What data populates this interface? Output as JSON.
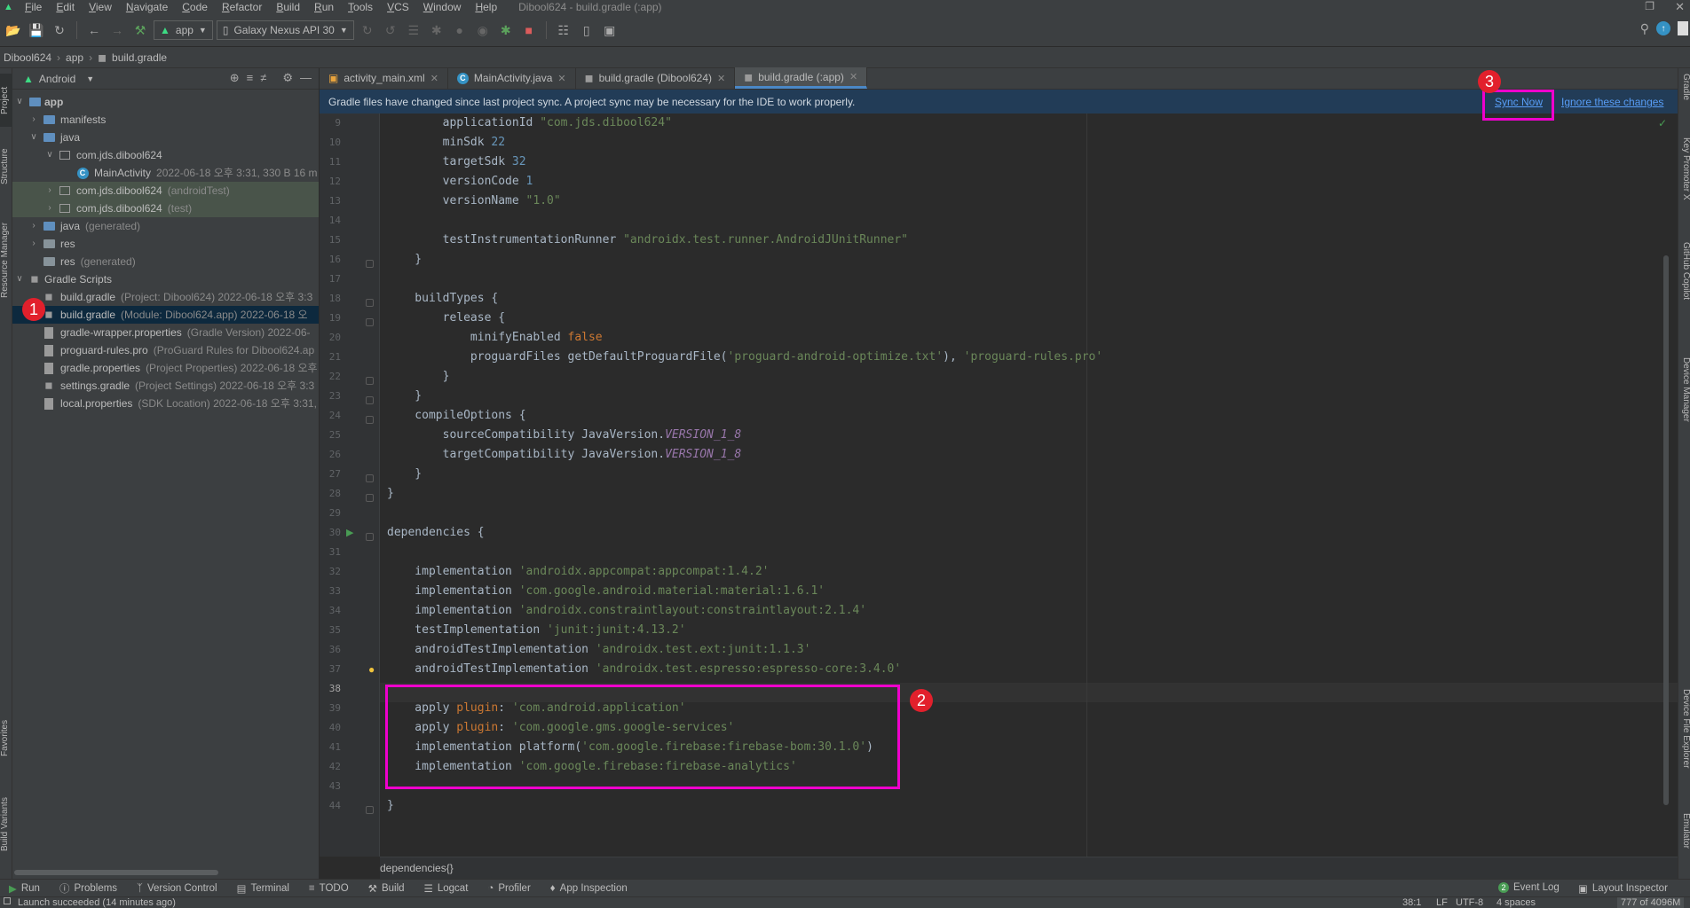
{
  "window_title": "Dibool624 - build.gradle (:app)",
  "menu": [
    "File",
    "Edit",
    "View",
    "Navigate",
    "Code",
    "Refactor",
    "Build",
    "Run",
    "Tools",
    "VCS",
    "Window",
    "Help"
  ],
  "toolbar": {
    "run_config": "app",
    "device": "Galaxy Nexus API 30"
  },
  "breadcrumb": [
    "Dibool624",
    "app",
    "build.gradle"
  ],
  "left_strip": [
    "Project",
    "Structure",
    "Resource Manager",
    "Favorites",
    "Build Variants"
  ],
  "right_strip": [
    "Gradle",
    "Key Promoter X",
    "GitHub Copilot",
    "Device Manager",
    "Device File Explorer",
    "Emulator"
  ],
  "project_panel": {
    "view_mode": "Android"
  },
  "tree": [
    {
      "label": "app",
      "meta": ""
    },
    {
      "label": "manifests",
      "meta": ""
    },
    {
      "label": "java",
      "meta": ""
    },
    {
      "label": "com.jds.dibool624",
      "meta": ""
    },
    {
      "label": "MainActivity",
      "meta": "2022-06-18 오후 3:31, 330 B 16 m"
    },
    {
      "label": "com.jds.dibool624",
      "meta": "(androidTest)"
    },
    {
      "label": "com.jds.dibool624",
      "meta": "(test)"
    },
    {
      "label": "java",
      "meta": "(generated)"
    },
    {
      "label": "res",
      "meta": ""
    },
    {
      "label": "res",
      "meta": "(generated)"
    },
    {
      "label": "Gradle Scripts",
      "meta": ""
    },
    {
      "label": "build.gradle",
      "meta": "(Project: Dibool624)  2022-06-18 오후 3:3"
    },
    {
      "label": "build.gradle",
      "meta": "(Module: Dibool624.app)  2022-06-18 오"
    },
    {
      "label": "gradle-wrapper.properties",
      "meta": "(Gradle Version)  2022-06-"
    },
    {
      "label": "proguard-rules.pro",
      "meta": "(ProGuard Rules for Dibool624.ap"
    },
    {
      "label": "gradle.properties",
      "meta": "(Project Properties)  2022-06-18 오후"
    },
    {
      "label": "settings.gradle",
      "meta": "(Project Settings)  2022-06-18 오후 3:3"
    },
    {
      "label": "local.properties",
      "meta": "(SDK Location)  2022-06-18 오후 3:31,"
    }
  ],
  "tabs": [
    "activity_main.xml",
    "MainActivity.java",
    "build.gradle (Dibool624)",
    "build.gradle (:app)"
  ],
  "notification": {
    "message": "Gradle files have changed since last project sync. A project sync may be necessary for the IDE to work properly.",
    "sync": "Sync Now",
    "ignore": "Ignore these changes"
  },
  "line_numbers": [
    "9",
    "10",
    "11",
    "12",
    "13",
    "14",
    "15",
    "16",
    "17",
    "18",
    "19",
    "20",
    "21",
    "22",
    "23",
    "24",
    "25",
    "26",
    "27",
    "28",
    "29",
    "30",
    "31",
    "32",
    "33",
    "34",
    "35",
    "36",
    "37",
    "38",
    "39",
    "40",
    "41",
    "42",
    "43",
    "44"
  ],
  "code": [
    [
      {
        "t": "        applicationId ",
        "c": ""
      },
      {
        "t": "\"com.jds.dibool624\"",
        "c": "str"
      }
    ],
    [
      {
        "t": "        minSdk ",
        "c": ""
      },
      {
        "t": "22",
        "c": "num"
      }
    ],
    [
      {
        "t": "        targetSdk ",
        "c": ""
      },
      {
        "t": "32",
        "c": "num"
      }
    ],
    [
      {
        "t": "        versionCode ",
        "c": ""
      },
      {
        "t": "1",
        "c": "num"
      }
    ],
    [
      {
        "t": "        versionName ",
        "c": ""
      },
      {
        "t": "\"1.0\"",
        "c": "str"
      }
    ],
    [],
    [
      {
        "t": "        testInstrumentationRunner ",
        "c": ""
      },
      {
        "t": "\"androidx.test.runner.AndroidJUnitRunner\"",
        "c": "str"
      }
    ],
    [
      {
        "t": "    }",
        "c": ""
      }
    ],
    [],
    [
      {
        "t": "    buildTypes {",
        "c": ""
      }
    ],
    [
      {
        "t": "        release {",
        "c": ""
      }
    ],
    [
      {
        "t": "            minifyEnabled ",
        "c": ""
      },
      {
        "t": "false",
        "c": "kw"
      }
    ],
    [
      {
        "t": "            proguardFiles getDefaultProguardFile(",
        "c": ""
      },
      {
        "t": "'proguard-android-optimize.txt'",
        "c": "str"
      },
      {
        "t": "), ",
        "c": ""
      },
      {
        "t": "'proguard-rules.pro'",
        "c": "str"
      }
    ],
    [
      {
        "t": "        }",
        "c": ""
      }
    ],
    [
      {
        "t": "    }",
        "c": ""
      }
    ],
    [
      {
        "t": "    compileOptions {",
        "c": ""
      }
    ],
    [
      {
        "t": "        sourceCompatibility JavaVersion.",
        "c": ""
      },
      {
        "t": "VERSION_1_8",
        "c": "ital"
      }
    ],
    [
      {
        "t": "        targetCompatibility JavaVersion.",
        "c": ""
      },
      {
        "t": "VERSION_1_8",
        "c": "ital"
      }
    ],
    [
      {
        "t": "    }",
        "c": ""
      }
    ],
    [
      {
        "t": "}",
        "c": ""
      }
    ],
    [],
    [
      {
        "t": "dependencies {",
        "c": ""
      }
    ],
    [],
    [
      {
        "t": "    implementation ",
        "c": ""
      },
      {
        "t": "'androidx.appcompat:appcompat:1.4.2'",
        "c": "str"
      }
    ],
    [
      {
        "t": "    implementation ",
        "c": ""
      },
      {
        "t": "'com.google.android.material:material:1.6.1'",
        "c": "str"
      }
    ],
    [
      {
        "t": "    implementation ",
        "c": ""
      },
      {
        "t": "'androidx.constraintlayout:constraintlayout:2.1.4'",
        "c": "str"
      }
    ],
    [
      {
        "t": "    testImplementation ",
        "c": ""
      },
      {
        "t": "'junit:junit:4.13.2'",
        "c": "str"
      }
    ],
    [
      {
        "t": "    androidTestImplementation ",
        "c": ""
      },
      {
        "t": "'androidx.test.ext:junit:1.1.3'",
        "c": "str"
      }
    ],
    [
      {
        "t": "    androidTestImplementation ",
        "c": ""
      },
      {
        "t": "'androidx.test.espresso:espresso-core:3.4.0'",
        "c": "str"
      }
    ],
    [],
    [
      {
        "t": "    apply ",
        "c": ""
      },
      {
        "t": "plugin",
        "c": "kw"
      },
      {
        "t": ": ",
        "c": ""
      },
      {
        "t": "'com.android.application'",
        "c": "str"
      }
    ],
    [
      {
        "t": "    apply ",
        "c": ""
      },
      {
        "t": "plugin",
        "c": "kw"
      },
      {
        "t": ": ",
        "c": ""
      },
      {
        "t": "'com.google.gms.google-services'",
        "c": "str"
      }
    ],
    [
      {
        "t": "    implementation platform(",
        "c": ""
      },
      {
        "t": "'com.google.firebase:firebase-bom:30.1.0'",
        "c": "str"
      },
      {
        "t": ")",
        "c": ""
      }
    ],
    [
      {
        "t": "    implementation ",
        "c": ""
      },
      {
        "t": "'com.google.firebase:firebase-analytics'",
        "c": "str"
      }
    ],
    [],
    [
      {
        "t": "}",
        "c": ""
      }
    ]
  ],
  "editor_breadcrumb": "dependencies{}",
  "bottom_tools": [
    "Run",
    "Problems",
    "Version Control",
    "Terminal",
    "TODO",
    "Build",
    "Logcat",
    "Profiler",
    "App Inspection"
  ],
  "bottom_right": [
    "Event Log",
    "Layout Inspector"
  ],
  "event_log_count": "2",
  "status": {
    "message": "Launch succeeded (14 minutes ago)",
    "position": "38:1",
    "line_sep": "LF",
    "encoding": "UTF-8",
    "indent": "4 spaces",
    "memory": "777 of 4096M"
  },
  "annotations": [
    "1",
    "2",
    "3"
  ],
  "colors": {
    "highlight": "#ee00cc",
    "badge": "#e2202c",
    "selection": "#0d293e",
    "link": "#589df6"
  }
}
